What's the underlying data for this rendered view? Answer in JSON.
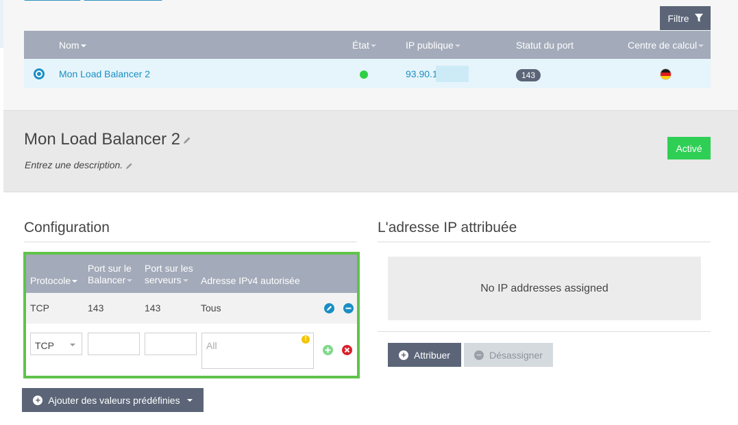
{
  "toolbar": {
    "filter_label": "Filtre"
  },
  "list_table": {
    "columns": [
      "Nom",
      "État",
      "IP publique",
      "Statut du port",
      "Centre de calcul"
    ],
    "row": {
      "name": "Mon Load Balancer 2",
      "state_color": "#2fcf45",
      "ip_public": "93.90.1",
      "port_status": "143",
      "datacenter_flag": "germany-flag-icon"
    }
  },
  "detail": {
    "title": "Mon Load Balancer 2",
    "description_placeholder": "Entrez une description.",
    "status_label": "Activé"
  },
  "configuration": {
    "title": "Configuration",
    "columns": {
      "protocol": "Protocole",
      "port_lb_line1": "Port sur le",
      "port_lb_line2": "Balancer",
      "port_srv_line1": "Port sur les",
      "port_srv_line2": "serveurs",
      "ipv4": "Adresse IPv4 autorisée"
    },
    "rule": {
      "protocol": "TCP",
      "port_lb": "143",
      "port_srv": "143",
      "ipv4": "Tous"
    },
    "new_rule": {
      "protocol_selected": "TCP",
      "ipv4_placeholder": "All"
    },
    "predefined_button": "Ajouter des valeurs prédéfinies"
  },
  "ip_section": {
    "title": "L'adresse IP attribuée",
    "empty_message": "No IP addresses assigned",
    "assign_label": "Attribuer",
    "unassign_label": "Désassigner"
  },
  "colors": {
    "accent_blue": "#1a8ec4",
    "header_gray": "#a3aab9",
    "button_dark": "#5b6577",
    "active_green": "#2fcf55",
    "config_border_green": "#5fc34a",
    "delete_red": "#d9202b"
  }
}
